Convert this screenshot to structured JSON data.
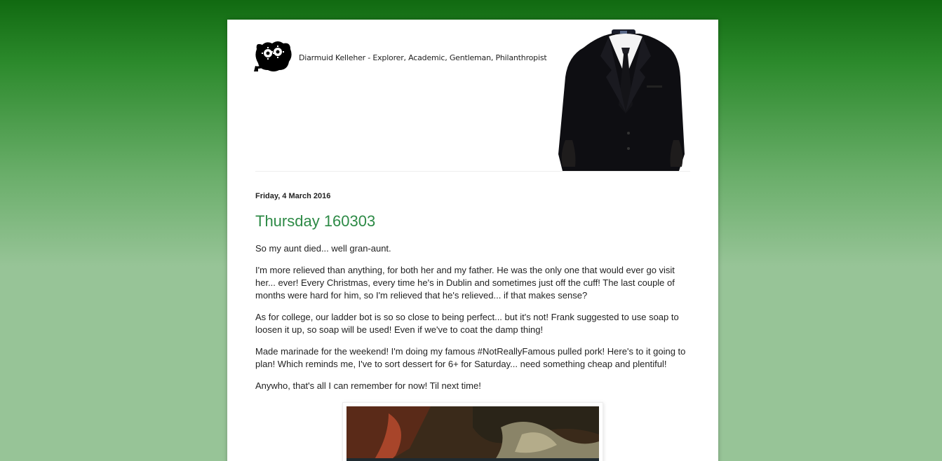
{
  "header": {
    "tagline": "Diarmuid Kelleher - Explorer, Academic, Gentleman, Philanthropist"
  },
  "post": {
    "date": "Friday, 4 March 2016",
    "title": "Thursday 160303",
    "paragraphs": [
      "So my aunt died... well gran-aunt.",
      "I'm more relieved than anything, for both her and my father. He was the only one that would ever go visit her... ever! Every Christmas, every time he's in Dublin and sometimes just off the cuff! The last couple of months were hard for him, so I'm relieved that he's relieved... if that makes sense?",
      "As for college, our ladder bot is so so close to being perfect... but it's not! Frank suggested to use soap to loosen it up, so soap will be used! Even if we've to coat the damp thing!",
      "Made marinade for the weekend! I'm doing my famous #NotReallyFamous pulled pork! Here's to it going to plan! Which reminds me, I've to sort dessert for 6+ for Saturday... need something cheap and plentiful!",
      "Anywho, that's all I can remember for now! Til next time!"
    ]
  },
  "colors": {
    "title": "#2d8a46",
    "background_top": "#116a11",
    "background_bottom": "#97c497"
  },
  "icons": {
    "logo": "gear-creature-logo",
    "header_image": "headless-suit-image",
    "post_photo": "post-photo"
  }
}
